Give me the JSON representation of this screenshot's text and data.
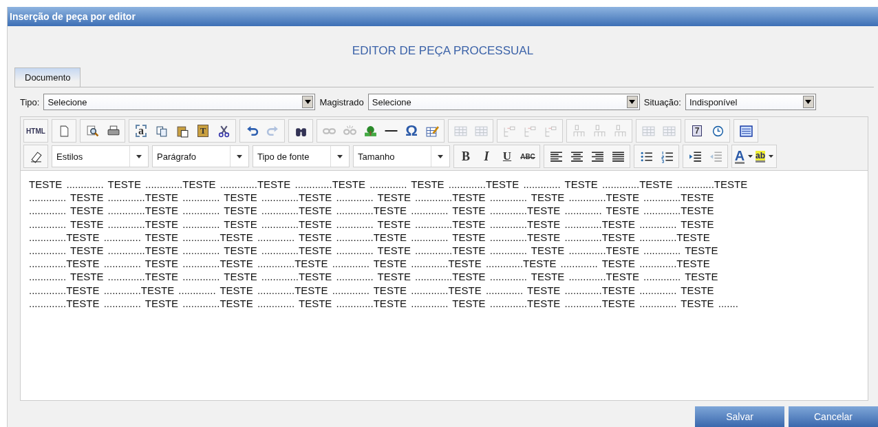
{
  "window": {
    "title": "Inserção de peça por editor"
  },
  "heading": "EDITOR DE PEÇA PROCESSUAL",
  "tabs": [
    {
      "label": "Documento",
      "selected": true
    }
  ],
  "fields": [
    {
      "label": "Tipo:",
      "value": "Selecione"
    },
    {
      "label": "Magistrado",
      "value": "Selecione"
    },
    {
      "label": "Situação:",
      "value": "Indisponível"
    }
  ],
  "toolbar_row_1": [
    [
      {
        "kind": "html",
        "label": "HTML",
        "disabled": false
      }
    ],
    [
      {
        "kind": "new-page",
        "disabled": false
      }
    ],
    [
      {
        "kind": "preview",
        "disabled": false
      },
      {
        "kind": "print",
        "disabled": false
      }
    ],
    [
      {
        "kind": "select-all",
        "label": "a",
        "disabled": false
      },
      {
        "kind": "copy",
        "disabled": false
      },
      {
        "kind": "paste",
        "disabled": false
      },
      {
        "kind": "paste-text",
        "label": "T",
        "disabled": false
      },
      {
        "kind": "cut",
        "disabled": false
      }
    ],
    [
      {
        "kind": "undo",
        "disabled": false
      },
      {
        "kind": "redo",
        "disabled": true
      }
    ],
    [
      {
        "kind": "find",
        "disabled": false
      }
    ],
    [
      {
        "kind": "link",
        "disabled": true
      },
      {
        "kind": "unlink",
        "disabled": true
      },
      {
        "kind": "image",
        "disabled": false
      },
      {
        "kind": "rule",
        "disabled": false
      },
      {
        "kind": "omega",
        "label": "Ω",
        "disabled": false
      },
      {
        "kind": "table-edit",
        "disabled": false
      }
    ],
    [
      {
        "kind": "table-row",
        "disabled": true
      },
      {
        "kind": "table-cell",
        "disabled": true
      }
    ],
    [
      {
        "kind": "row-before",
        "disabled": true
      },
      {
        "kind": "row-after",
        "disabled": true
      },
      {
        "kind": "row-delete",
        "disabled": true
      }
    ],
    [
      {
        "kind": "col-before",
        "disabled": true
      },
      {
        "kind": "col-after",
        "disabled": true
      },
      {
        "kind": "col-delete",
        "disabled": true
      }
    ],
    [
      {
        "kind": "grid",
        "disabled": true
      },
      {
        "kind": "grid",
        "disabled": true
      }
    ],
    [
      {
        "kind": "calendar",
        "label": "7",
        "disabled": false
      },
      {
        "kind": "clock",
        "disabled": false
      }
    ],
    [
      {
        "kind": "window",
        "disabled": false
      }
    ]
  ],
  "toolbar_row_2": [
    {
      "kind": "button",
      "items": [
        {
          "kind": "eraser",
          "disabled": false
        }
      ]
    },
    {
      "kind": "dropdown",
      "label": "Estilos"
    },
    {
      "kind": "dropdown",
      "label": "Parágrafo"
    },
    {
      "kind": "dropdown",
      "label": "Tipo de fonte"
    },
    {
      "kind": "dropdown",
      "label": "Tamanho"
    },
    {
      "kind": "button",
      "items": [
        {
          "kind": "bold",
          "label": "B",
          "disabled": false
        },
        {
          "kind": "italic",
          "label": "I",
          "disabled": false
        },
        {
          "kind": "underline",
          "label": "U",
          "disabled": false
        },
        {
          "kind": "strike",
          "label": "ABC",
          "disabled": false
        }
      ]
    },
    {
      "kind": "button",
      "items": [
        {
          "kind": "align-left",
          "disabled": false
        },
        {
          "kind": "align-center",
          "disabled": false
        },
        {
          "kind": "align-right",
          "disabled": false
        },
        {
          "kind": "align-justify",
          "disabled": false
        }
      ]
    },
    {
      "kind": "button",
      "items": [
        {
          "kind": "bullets",
          "disabled": false
        },
        {
          "kind": "numbers",
          "disabled": false
        }
      ]
    },
    {
      "kind": "button",
      "items": [
        {
          "kind": "indent",
          "disabled": false
        },
        {
          "kind": "outdent",
          "disabled": true
        }
      ]
    },
    {
      "kind": "button",
      "items": [
        {
          "kind": "font-color",
          "label": "A",
          "disabled": false
        },
        {
          "kind": "highlight",
          "label": "ab",
          "disabled": false
        }
      ]
    }
  ],
  "document_lines": [
    "TESTE ............. TESTE .............TESTE .............TESTE .............TESTE ............. TESTE .............TESTE ............. TESTE .............TESTE .............TESTE",
    "............. TESTE .............TESTE ............. TESTE .............TESTE ............. TESTE .............TESTE ............. TESTE .............TESTE .............TESTE",
    "............. TESTE .............TESTE ............. TESTE .............TESTE .............TESTE ............. TESTE .............TESTE ............. TESTE .............TESTE",
    "............. TESTE .............TESTE ............. TESTE .............TESTE ............. TESTE .............TESTE .............TESTE .............TESTE ............. TESTE",
    ".............TESTE ............. TESTE .............TESTE ............. TESTE .............TESTE ............. TESTE .............TESTE .............TESTE .............TESTE",
    "............. TESTE .............TESTE ............. TESTE .............TESTE ............. TESTE .............TESTE ............. TESTE .............TESTE ............. TESTE",
    ".............TESTE ............. TESTE .............TESTE .............TESTE ............. TESTE .............TESTE .............TESTE ............. TESTE .............TESTE",
    "............. TESTE .............TESTE ............. TESTE .............TESTE ............. TESTE .............TESTE ............. TESTE .............TESTE ............. TESTE",
    ".............TESTE .............TESTE ............. TESTE .............TESTE ............. TESTE .............TESTE ............. TESTE .............TESTE ............. TESTE",
    ".............TESTE ............. TESTE .............TESTE ............. TESTE .............TESTE ............. TESTE .............TESTE .............TESTE ............. TESTE ......."
  ],
  "buttons": [
    "Salvar",
    "Cancelar"
  ]
}
